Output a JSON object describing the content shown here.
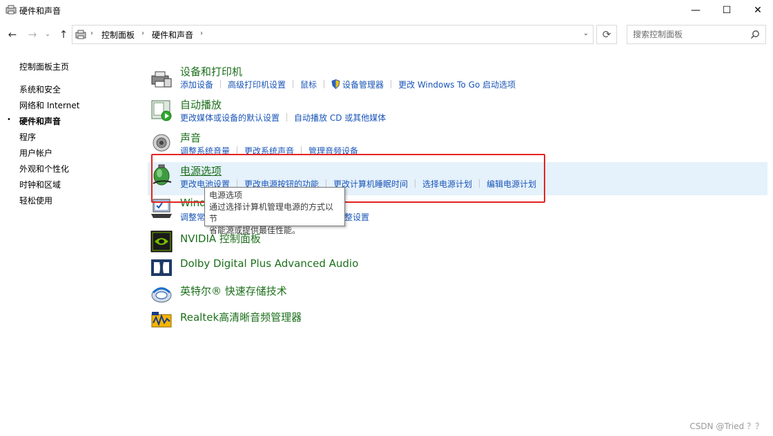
{
  "window": {
    "title": "硬件和声音",
    "minimize": "—",
    "maximize": "☐",
    "close": "✕"
  },
  "nav": {
    "back": "←",
    "forward": "→",
    "recent": "⌄",
    "up": "↑"
  },
  "address": {
    "crumbs": [
      "控制面板",
      "硬件和声音"
    ],
    "separator": "›",
    "dropdown": "⌄"
  },
  "refresh": "⟳",
  "search": {
    "placeholder": "搜索控制面板"
  },
  "leftnav": {
    "home": "控制面板主页",
    "items": [
      {
        "label": "系统和安全"
      },
      {
        "label": "网络和 Internet"
      },
      {
        "label": "硬件和声音",
        "active": true
      },
      {
        "label": "程序"
      },
      {
        "label": "用户帐户"
      },
      {
        "label": "外观和个性化"
      },
      {
        "label": "时钟和区域"
      },
      {
        "label": "轻松使用"
      }
    ],
    "bullet": "•"
  },
  "categories": [
    {
      "title": "设备和打印机",
      "links": [
        "添加设备",
        "高级打印机设置",
        "鼠标",
        "设备管理器",
        "更改 Windows To Go 启动选项"
      ]
    },
    {
      "title": "自动播放",
      "links": [
        "更改媒体或设备的默认设置",
        "自动播放 CD 或其他媒体"
      ]
    },
    {
      "title": "声音",
      "links": [
        "调整系统音量",
        "更改系统声音",
        "管理音频设备"
      ]
    },
    {
      "title": "电源选项",
      "links": [
        "更改电池设置",
        "更改电源按钮的功能",
        "更改计算机睡眠时间",
        "选择电源计划",
        "编辑电源计划"
      ]
    },
    {
      "title": "Windows 移动中心",
      "title_visible": "Wind",
      "links": [
        "调整常用移动设置",
        "演示前调整设置"
      ],
      "links_visible": [
        "调整常",
        "整设置"
      ]
    },
    {
      "title": "NVIDIA 控制面板"
    },
    {
      "title": "Dolby Digital Plus Advanced Audio"
    },
    {
      "title": "英特尔® 快速存储技术"
    },
    {
      "title": "Realtek高清晰音频管理器"
    }
  ],
  "tooltip": {
    "title": "电源选项",
    "line1": "通过选择计算机管理电源的方式以节",
    "line2": "省能源或提供最佳性能。"
  },
  "watermark": "CSDN @Tried ？？",
  "colors": {
    "category_title": "#1c6f1c",
    "link": "#1a55b8",
    "highlight_bg": "#e5f1fb",
    "annotation_border": "#e3231f"
  }
}
